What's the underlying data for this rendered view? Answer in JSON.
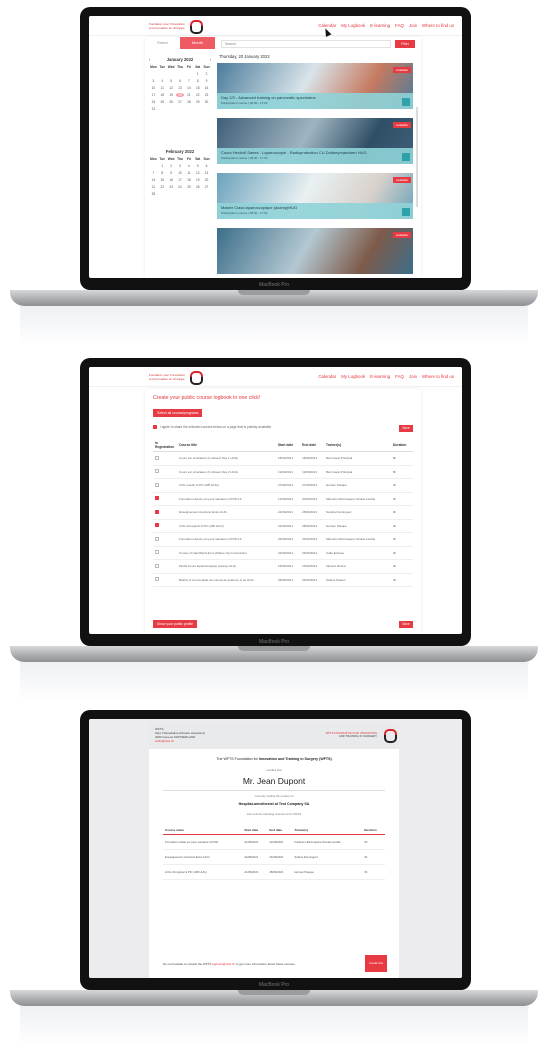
{
  "laptop_brand": "MacBook Pro",
  "nav": [
    "Calendar",
    "My Logbook",
    "E-learning",
    "FAQ",
    "Join",
    "Where to find us"
  ],
  "screen1": {
    "tabs": [
      "Event",
      "Month"
    ],
    "search_placeholder": "Search",
    "search_button": "Filter",
    "day_title": "Thursday, 20 January 2022",
    "calendars": [
      {
        "month": "January 2022",
        "dow": [
          "Mon",
          "Tue",
          "Wed",
          "Thu",
          "Fri",
          "Sat",
          "Sun"
        ],
        "leading_blanks": 5,
        "days": 31,
        "selected": 20
      },
      {
        "month": "February 2022",
        "dow": [
          "Mon",
          "Tue",
          "Wed",
          "Thu",
          "Fri",
          "Sat",
          "Sun"
        ],
        "leading_blanks": 1,
        "days": 28,
        "selected": 0
      }
    ],
    "cards": [
      {
        "title": "Day 2/3 - Advanced training on pancreatic specimens",
        "sub": "Participation course | 08:00 - 17:00",
        "badge": "Available",
        "palette": [
          "#4b7c9b",
          "#d9e4ea",
          "#c67a60"
        ]
      },
      {
        "title": "Cours Hecholi Sanes - Laparoscopie - Radioprotection CU Dolbreymanvlsen HUG",
        "sub": "Participation course | 08:00 - 17:00",
        "badge": "Available",
        "palette": [
          "#3f5f79",
          "#9fb4c1",
          "#2f4f66"
        ]
      },
      {
        "title": "Master Class laparoscopique (acamp)HUG",
        "sub": "Participation course | 08:00 - 17:00",
        "badge": "Available",
        "palette": [
          "#6aa2bb",
          "#e9f0f2",
          "#d8d1cb"
        ]
      },
      {
        "title": "",
        "sub": "",
        "badge": "Available",
        "palette": [
          "#3c6e8a",
          "#b3c8d2",
          "#7e5b4a"
        ]
      }
    ]
  },
  "screen2": {
    "title": "Create your public course logbook in one click!",
    "select_button": "Select all course/programs",
    "checkbox_label": "I agree to share the selected courses below on a page that is publicly available",
    "save_button": "Save",
    "columns": [
      "In Registration",
      "Course title",
      "Start date",
      "End date",
      "Trainer(s)",
      "Duration"
    ],
    "rows": [
      {
        "checked": false,
        "title": "Cours sur simulateur (Iv dissect Day 1 HUG)",
        "start": "18/09/2021",
        "end": "18/09/2021",
        "trainer": "Bart Garat Principal",
        "dur": "5h"
      },
      {
        "checked": false,
        "title": "Cours sur simulateur (Iv dissect Day 2 HUG)",
        "start": "19/09/2021",
        "end": "19/09/2021",
        "trainer": "Bart Garat Principal",
        "dur": "5h"
      },
      {
        "checked": false,
        "title": "LOG results & PIC (ABI HUG)",
        "start": "27/09/2021",
        "end": "27/09/2021",
        "trainer": "Hernan Pasque",
        "dur": "3h"
      },
      {
        "checked": true,
        "title": "Formation Hecole sur peur sanitaire COVID-19",
        "start": "12/09/2021",
        "end": "20/09/2021",
        "trainer": "Marcelo Hilicrimagine Nicolas Hucille",
        "dur": "3h"
      },
      {
        "checked": true,
        "title": "Enseignement structurel Entre HUG",
        "start": "24/09/2021",
        "end": "28/09/2021",
        "trainer": "Sandra Dominguez",
        "dur": "3h"
      },
      {
        "checked": true,
        "title": "LOG chirurgical & PIC (ABI HUG)",
        "start": "21/09/2021",
        "end": "28/09/2021",
        "trainer": "Hernan Pasque",
        "dur": "3h"
      },
      {
        "checked": false,
        "title": "Formation Hecole sur peur sanitaire COVID-19",
        "start": "23/09/2021",
        "end": "25/09/2021",
        "trainer": "Marcelo Hilicrimagine Nicolas Hucille",
        "dur": "3h"
      },
      {
        "checked": false,
        "title": "Cursus of Handball (Horns (Plates of)) construction",
        "start": "22/09/2021",
        "end": "25/09/2021",
        "trainer": "Calle Enrique",
        "dur": "3h"
      },
      {
        "checked": false,
        "title": "Model Cours laparoscopique (acamp HLG)",
        "start": "15/09/2021",
        "end": "15/09/2021",
        "trainer": "Varsent Retina",
        "dur": "3h"
      },
      {
        "checked": false,
        "title": "Basics of unsmonaide de cuenta de anatomy in pe HUG",
        "start": "25/09/2021",
        "end": "25/09/2021",
        "trainer": "Sabine Patson",
        "dur": "3h"
      }
    ],
    "footer_button": "Show your public profile",
    "footer_save": "Save"
  },
  "screen3": {
    "head_left": [
      "WFTS",
      "Alps Chanedaline-Parasta Hospital at",
      "4000 Geneva SWITZERLAND",
      "swfts@wfts.ch"
    ],
    "head_right": [
      "WFTS FOUNDATION FOR INNOVATION",
      "AND TRAINING IN SURGERY"
    ],
    "line1_pre": "The WFTS Foundation for ",
    "line1_bold": "Innovation and Training in Surgery (WFTS)",
    "certifies": "certifies that",
    "name": "Mr. Jean Dupont",
    "holding": "currently holding the position of",
    "company": "Hospital-anesthesist at Test Company SA",
    "followed": "who took the following courses at the WFTS",
    "columns": [
      "Course name",
      "Start date",
      "End date",
      "Trainer(s)",
      "Duration"
    ],
    "rows": [
      {
        "name": "Formation mbale sur peur sanitaire COVID",
        "start": "21/09/2021",
        "end": "22/09/2021",
        "trainer": "Frédéric Hilicrimagine Nicolas Hucille",
        "dur": "3h"
      },
      {
        "name": "Enseignement structurel Entre HUG",
        "start": "24/09/2021",
        "end": "24/09/2021",
        "trainer": "Sabine Dominguez",
        "dur": "3h"
      },
      {
        "name": "LOG chirurgical & PIC (ABI HUG)",
        "start": "21/09/2021",
        "end": "28/09/2021",
        "trainer": "Hernan Pasque",
        "dur": "3h"
      }
    ],
    "footer_pre": "Do not hesitate to contact the WFTS ",
    "footer_link": "logbook@wfts.ch",
    "footer_post": " to get more information about these courses.",
    "footer_button": "Contact the WFTS"
  }
}
